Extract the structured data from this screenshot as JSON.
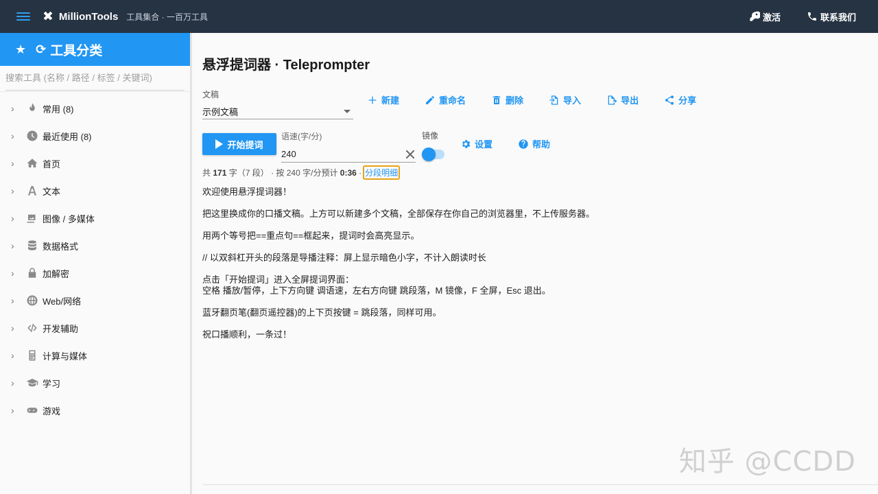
{
  "topbar": {
    "brand": "MillionTools",
    "tagline": "工具集合 · 一百万工具",
    "activate": "激活",
    "contact": "联系我们"
  },
  "sidebar": {
    "title": "工具分类",
    "search_placeholder": "搜索工具 (名称 / 路径 / 标签 / 关键词)",
    "items": [
      {
        "label": "常用 (8)",
        "icon": "fire-icon"
      },
      {
        "label": "最近使用 (8)",
        "icon": "clock-icon"
      },
      {
        "label": "首页",
        "icon": "home-icon"
      },
      {
        "label": "文本",
        "icon": "text-icon"
      },
      {
        "label": "图像 / 多媒体",
        "icon": "image-icon"
      },
      {
        "label": "数据格式",
        "icon": "database-icon"
      },
      {
        "label": "加解密",
        "icon": "lock-icon"
      },
      {
        "label": "Web/网络",
        "icon": "globe-icon"
      },
      {
        "label": "开发辅助",
        "icon": "code-icon"
      },
      {
        "label": "计算与媒体",
        "icon": "calculator-icon"
      },
      {
        "label": "学习",
        "icon": "graduation-cap-icon"
      },
      {
        "label": "游戏",
        "icon": "gamepad-icon"
      }
    ]
  },
  "main": {
    "title": "悬浮提词器 · Teleprompter",
    "doc_label": "文稿",
    "doc_selected": "示例文稿",
    "actions": {
      "new": "新建",
      "rename": "重命名",
      "delete": "删除",
      "import": "导入",
      "export": "导出",
      "share": "分享"
    },
    "start_label": "开始提词",
    "speed_label": "语速(字/分)",
    "speed_value": "240",
    "mirror_label": "镜像",
    "settings_label": "设置",
    "help_label": "帮助",
    "stats": {
      "prefix": "共",
      "chars": "171",
      "chars_unit": "字（7 段）",
      "rate_text": "· 按 240 字/分预计",
      "duration": "0:36",
      "sep": "·",
      "detail": "分段明细"
    },
    "script": [
      "欢迎使用悬浮提词器！",
      "把这里换成你的口播文稿。上方可以新建多个文稿，全部保存在你自己的浏览器里，不上传服务器。",
      "用两个等号把==重点句==框起来，提词时会高亮显示。",
      "// 以双斜杠开头的段落是导播注释：屏上显示暗色小字，不计入朗读时长",
      "点击「开始提词」进入全屏提词界面：\n空格 播放/暂停，上下方向键 调语速，左右方向键 跳段落，M 镜像，F 全屏，Esc 退出。",
      "蓝牙翻页笔(翻页遥控器)的上下页按键 = 跳段落，同样可用。",
      "祝口播顺利，一条过！"
    ]
  },
  "watermark": "知乎 @CCDD",
  "colors": {
    "topbar": "#263343",
    "accent": "#2196f3",
    "highlight_border": "#e8a21a"
  }
}
